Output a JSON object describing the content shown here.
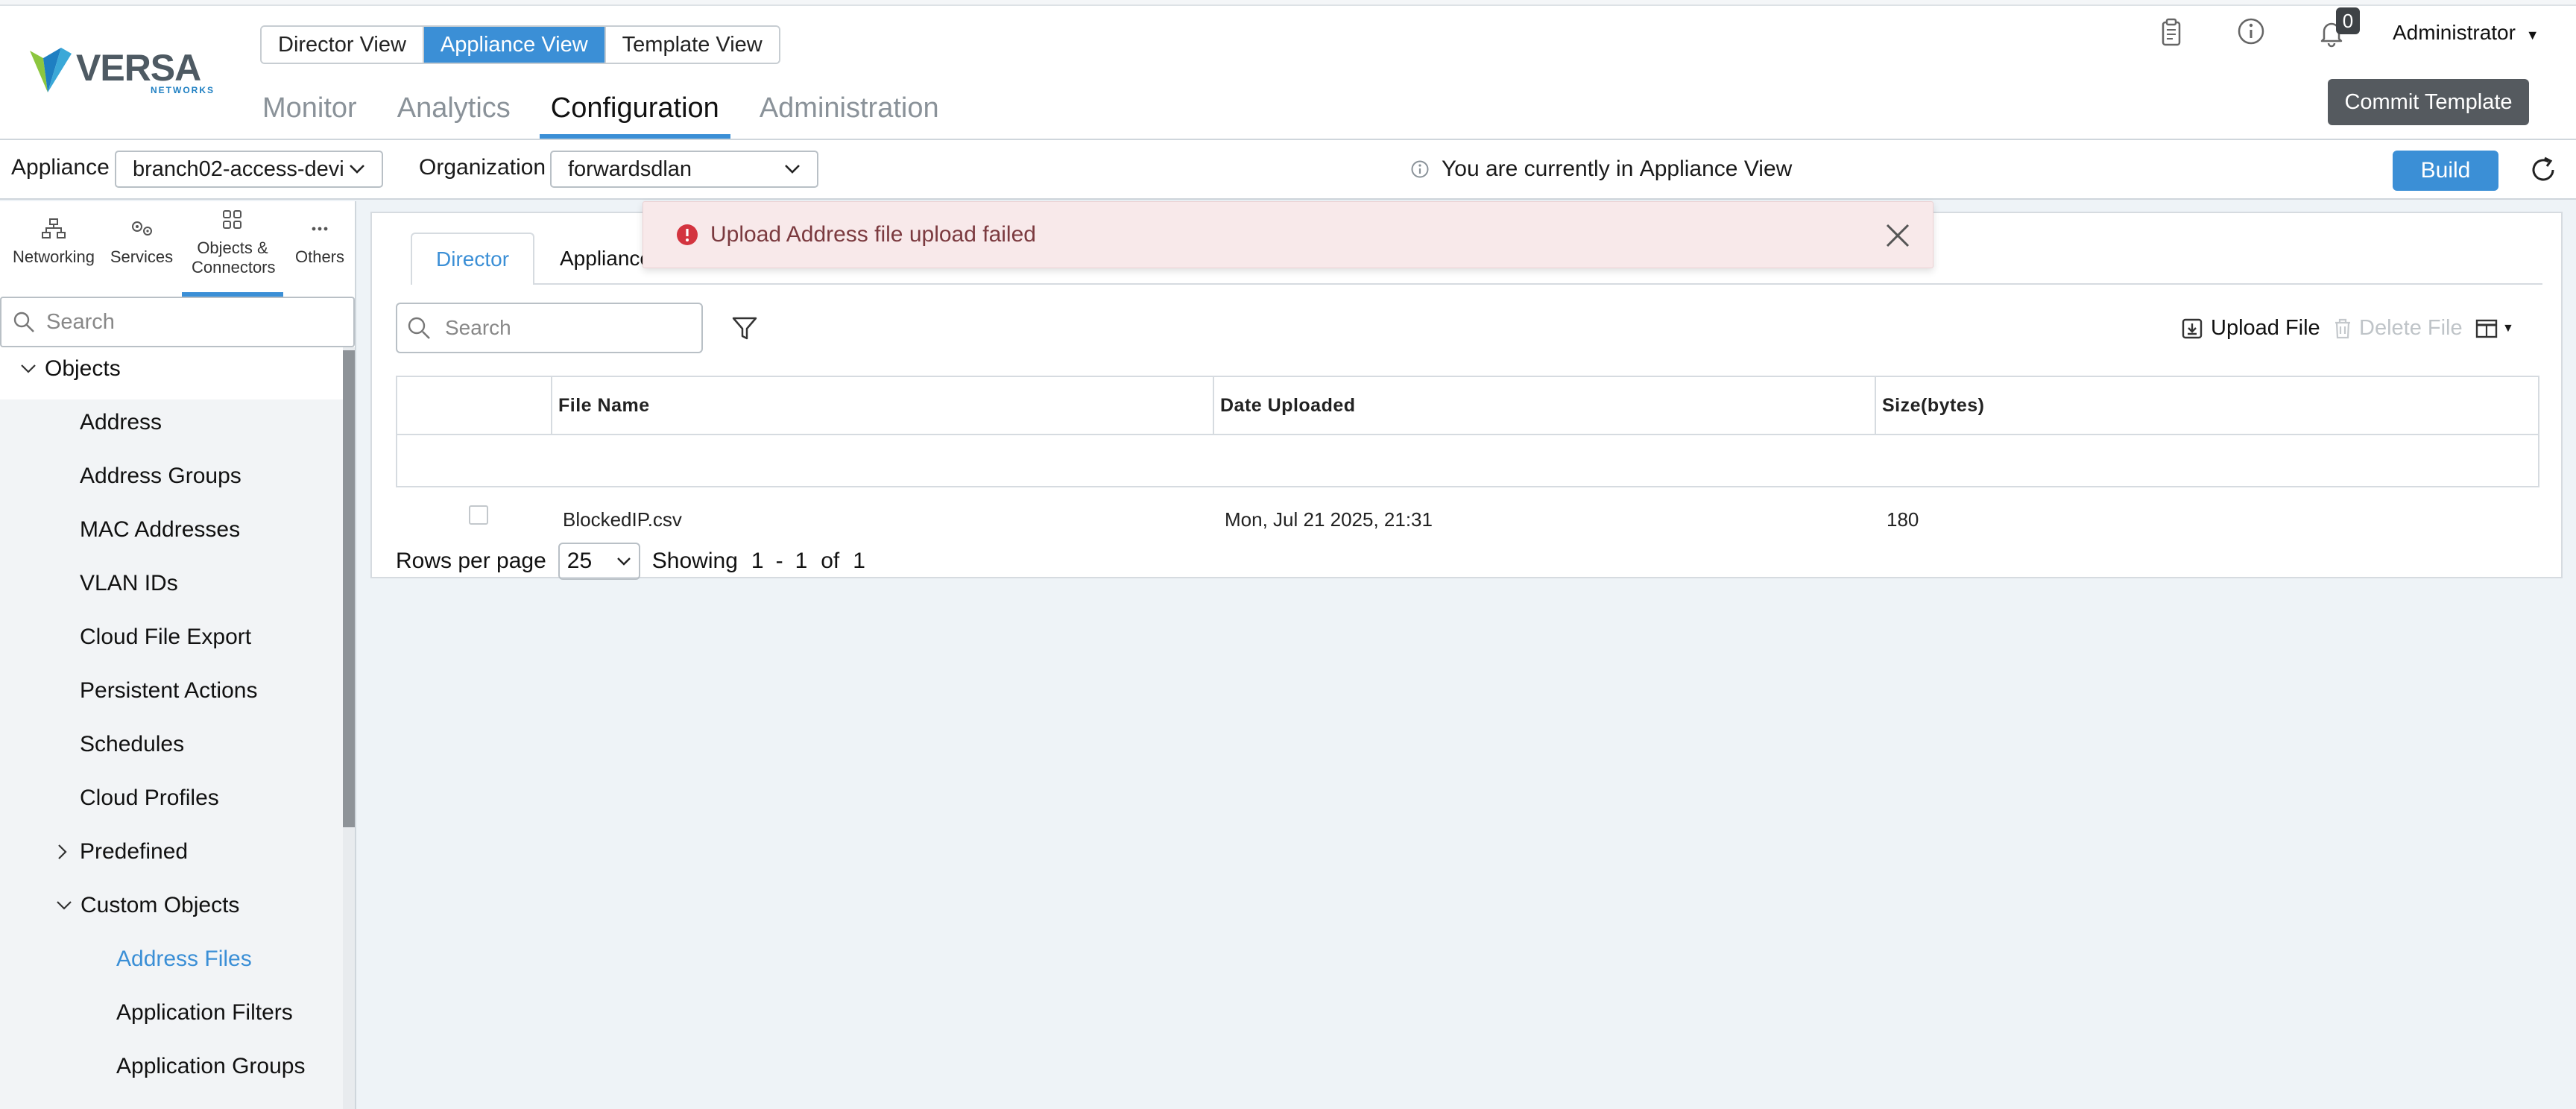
{
  "header": {
    "logo_text": "VERSA",
    "logo_sub": "NETWORKS",
    "views": [
      "Director View",
      "Appliance View",
      "Template View"
    ],
    "active_view_index": 1,
    "nav": [
      "Monitor",
      "Analytics",
      "Configuration",
      "Administration"
    ],
    "active_nav_index": 2,
    "notification_count": "0",
    "user": "Administrator",
    "commit_label": "Commit Template"
  },
  "context": {
    "appliance_label": "Appliance",
    "appliance_value": "branch02-access-devi",
    "organization_label": "Organization",
    "organization_value": "forwardsdlan",
    "info_prefix": "You are currently in ",
    "info_view": "Appliance View",
    "build_label": "Build"
  },
  "sidebar": {
    "tabs": [
      "Networking",
      "Services",
      "Objects & Connectors",
      "Others"
    ],
    "active_tab_index": 2,
    "search_placeholder": "Search",
    "tree": {
      "root": "Objects",
      "items": [
        "Address",
        "Address Groups",
        "MAC Addresses",
        "VLAN IDs",
        "Cloud File Export",
        "Persistent Actions",
        "Schedules",
        "Cloud Profiles"
      ],
      "predefined": "Predefined",
      "custom": "Custom Objects",
      "custom_items": [
        "Address Files",
        "Application Filters",
        "Application Groups"
      ],
      "selected": "Address Files"
    }
  },
  "main": {
    "tabs": [
      "Director",
      "Appliance"
    ],
    "active_tab_index": 0,
    "toast": "Upload Address file upload failed",
    "search_placeholder": "Search",
    "upload_label": "Upload File",
    "delete_label": "Delete File",
    "table": {
      "columns": [
        "File Name",
        "Date Uploaded",
        "Size(bytes)"
      ],
      "rows": [
        [
          "BlockedIP.csv",
          "Mon, Jul 21 2025, 21:31",
          "180"
        ]
      ]
    },
    "pager": {
      "rows_per_page_label": "Rows per page",
      "rows_per_page": "25",
      "showing_label": "Showing",
      "from": "1",
      "dash": "-",
      "to": "1",
      "of_label": "of",
      "total": "1"
    }
  },
  "colors": {
    "accent": "#3b8fd6",
    "commit_bg": "#555a5f",
    "toast_bg": "#f8e9ea",
    "error_icon": "#d3343f"
  }
}
